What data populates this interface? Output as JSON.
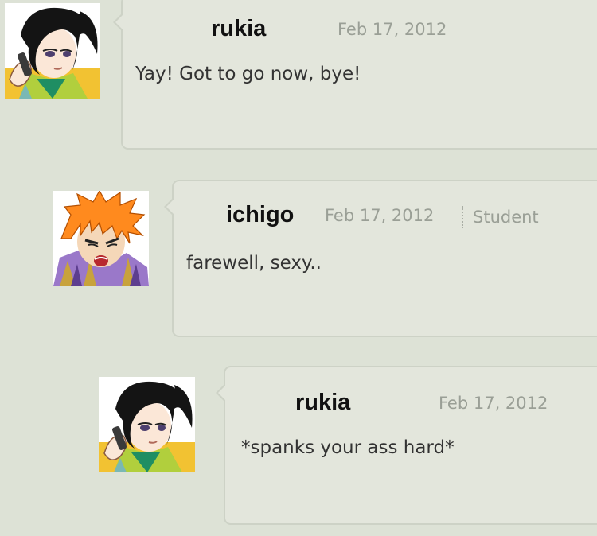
{
  "comments": [
    {
      "avatar": "rukia-avatar",
      "username": "rukia",
      "date": "Feb 17, 2012",
      "role": "",
      "message": "Yay! Got to go now, bye!"
    },
    {
      "avatar": "ichigo-avatar",
      "username": "ichigo",
      "date": "Feb 17, 2012",
      "role": "Student",
      "message": "farewell, sexy.."
    },
    {
      "avatar": "rukia-avatar",
      "username": "rukia",
      "date": "Feb 17, 2012",
      "role": "",
      "message": "*spanks your ass hard*"
    }
  ],
  "colors": {
    "page_background": "#dde2d6",
    "bubble_background": "#e3e6dc",
    "bubble_border": "#cdd2c6",
    "date_text": "#9a9f96",
    "username_text": "#111111"
  }
}
